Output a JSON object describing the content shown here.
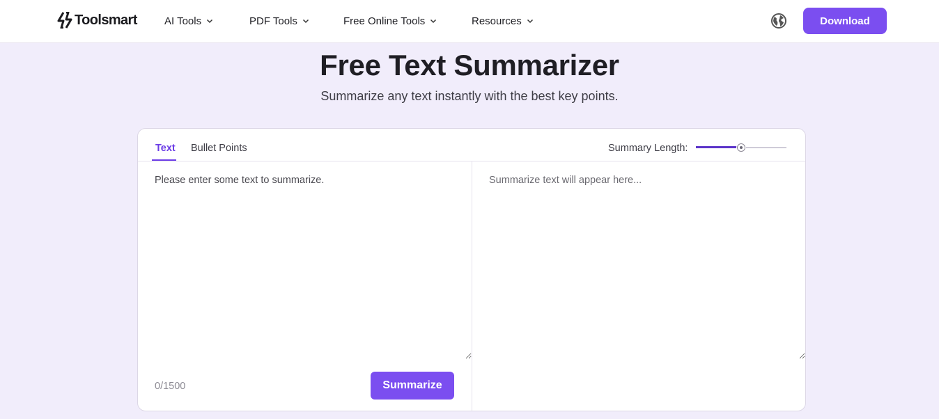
{
  "header": {
    "logo_text": "Toolsmart",
    "nav": [
      {
        "label": "AI Tools"
      },
      {
        "label": "PDF Tools"
      },
      {
        "label": "Free Online Tools"
      },
      {
        "label": "Resources"
      }
    ],
    "language_icon": "globe-icon",
    "download_label": "Download"
  },
  "main": {
    "title": "Free Text Summarizer",
    "subtitle": "Summarize any text instantly with the best key points."
  },
  "panel": {
    "tabs": [
      {
        "label": "Text",
        "active": true
      },
      {
        "label": "Bullet Points",
        "active": false
      }
    ],
    "summary_length_label": "Summary Length:",
    "summary_length_value": 0.5,
    "input": {
      "value": "",
      "placeholder": "Please enter some text to summarize."
    },
    "output": {
      "value": "",
      "placeholder": "Summarize text will appear here..."
    },
    "char_count": "0/1500",
    "summarize_label": "Summarize"
  },
  "colors": {
    "accent": "#7b4ef0",
    "accent_dark": "#6b3ce6",
    "page_background": "#f1edfb"
  }
}
